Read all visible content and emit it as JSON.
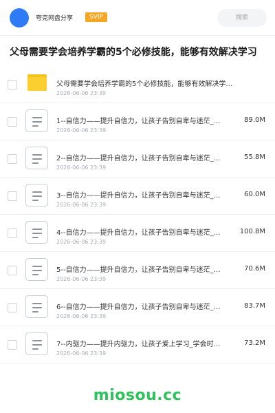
{
  "header": {
    "share_name": "夸克网盘分享",
    "badge": "SVIP",
    "search_label": "搜索"
  },
  "title": "父母需要学会培养学霸的5个必修技能，能够有效解决学习",
  "files": [
    {
      "type": "folder",
      "icon": "folder-icon",
      "name": "父母需要学会培养学霸的5个必修技能，能够有效解决学…",
      "date": "2026-06-06 23:39",
      "size": ""
    },
    {
      "type": "file",
      "icon": "document-icon",
      "name": "1--自信力——提升自信力，让孩子告别自卑与迷茫_…",
      "date": "2026-06-06 23:39",
      "size": "89.0M"
    },
    {
      "type": "file",
      "icon": "document-icon",
      "name": "2--自信力——提升自信力，让孩子告别自卑与迷茫_…",
      "date": "2026-06-06 23:39",
      "size": "55.8M"
    },
    {
      "type": "file",
      "icon": "document-icon",
      "name": "3--自信力——提升自信力，让孩子告别自卑与迷茫_…",
      "date": "2026-06-06 23:39",
      "size": "60.0M"
    },
    {
      "type": "file",
      "icon": "document-icon",
      "name": "4--自信力——提升自信力，让孩子告别自卑与迷茫_…",
      "date": "2026-06-06 23:39",
      "size": "100.8M"
    },
    {
      "type": "file",
      "icon": "document-icon",
      "name": "5--自信力——提升自信力，让孩子告别自卑与迷茫_…",
      "date": "2026-06-06 23:39",
      "size": "70.6M"
    },
    {
      "type": "file",
      "icon": "document-icon",
      "name": "6--自信力——提升自信力，让孩子告别自卑与迷茫_…",
      "date": "2026-06-06 23:39",
      "size": "83.7M"
    },
    {
      "type": "file",
      "icon": "document-icon",
      "name": "7--内驱力——提升内驱力，让孩子爱上学习_学会时…",
      "date": "2026-06-06 23:39",
      "size": "73.2M"
    }
  ],
  "watermark": "miosou.cc",
  "colors": {
    "avatar": "#2f7bf5",
    "svip": "#f5a623",
    "folder": "#fbcf2f",
    "watermark": "#2ec25a"
  }
}
